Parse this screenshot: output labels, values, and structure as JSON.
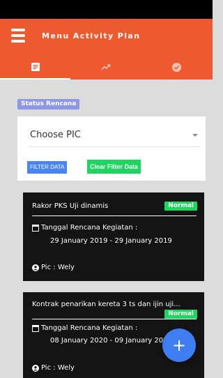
{
  "app_bar": {
    "title": "Menu Activity Plan",
    "menu_icon": "hamburger-icon"
  },
  "tabs": [
    {
      "icon": "list-icon",
      "active": true
    },
    {
      "icon": "trending-up-icon",
      "active": false
    },
    {
      "icon": "check-circle-icon",
      "active": false
    }
  ],
  "status_label": "Status Rencana",
  "filter": {
    "pic_placeholder": "Choose PIC",
    "filter_button": "FILTER DATA",
    "clear_button": "Clear Filter Data"
  },
  "plans": [
    {
      "title": "Rakor PKS Uji dinamis",
      "status": "Normal",
      "date_label": "Tanggal Rencana Kegiatan :",
      "date_range": "29 January 2019 - 29 January 2019",
      "pic": "Pic : Wely"
    },
    {
      "title": "Kontrak penarikan kereta 3 ts dan ijin uji...",
      "status": "Normal",
      "date_label": "Tanggal Rencana Kegiatan :",
      "date_range": "08 January 2020 - 09 January 2020",
      "pic": "Pic : Wely"
    }
  ],
  "fab_label": "+",
  "colors": {
    "primary": "#ee5a2f",
    "status_chip": "#8e97e6",
    "filter_button": "#4a84f0",
    "success": "#1ed65f",
    "card": "#141414",
    "fab": "#3f7df3"
  }
}
